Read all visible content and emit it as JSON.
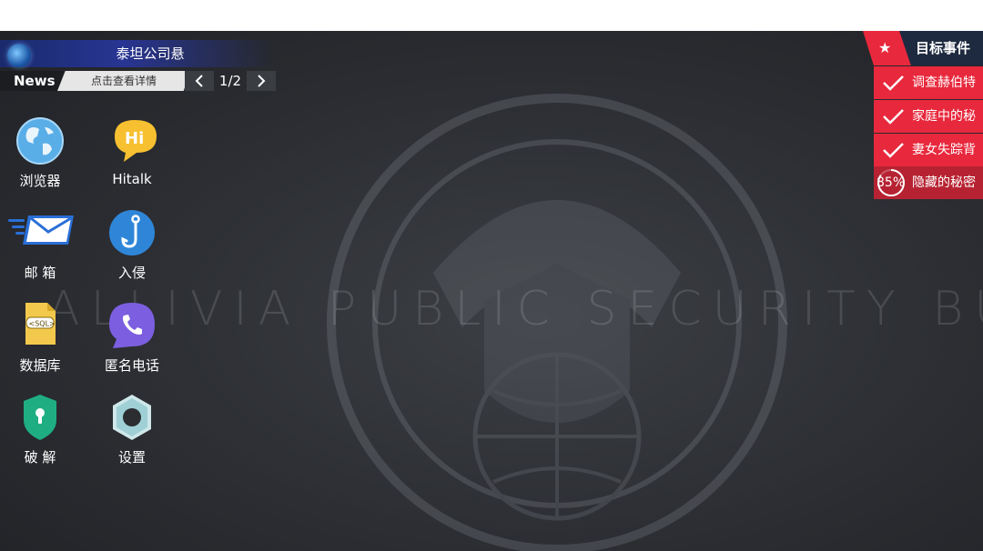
{
  "news": {
    "headline": "泰坦公司悬",
    "tag": "News",
    "detail": "点击查看详情",
    "page": "1/2",
    "prev_icon": "chevron-left-icon",
    "next_icon": "chevron-right-icon"
  },
  "apps": [
    {
      "label": "浏览器",
      "icon": "globe-icon"
    },
    {
      "label": "Hitalk",
      "icon": "hitalk-icon"
    },
    {
      "label": "邮 箱",
      "icon": "mail-icon"
    },
    {
      "label": "入侵",
      "icon": "hook-icon"
    },
    {
      "label": "数据库",
      "icon": "sql-file-icon"
    },
    {
      "label": "匿名电话",
      "icon": "phone-icon"
    },
    {
      "label": "破 解",
      "icon": "keyhole-shield-icon"
    },
    {
      "label": "设置",
      "icon": "settings-icon"
    }
  ],
  "objectives": {
    "title": "目标事件",
    "items": [
      {
        "text": "调查赫伯特",
        "status": "done"
      },
      {
        "text": "家庭中的秘",
        "status": "done"
      },
      {
        "text": "妻女失踪背",
        "status": "done"
      },
      {
        "text": "隐藏的秘密",
        "status": "in-progress",
        "progress": "85%",
        "progress_value": 0.85
      }
    ]
  },
  "watermark": "ALLIVIA  PUBLIC SECURITY BUREAU",
  "colors": {
    "accent_red": "#e8283c",
    "news_blue": "#283593",
    "background": "#2c2e33"
  }
}
